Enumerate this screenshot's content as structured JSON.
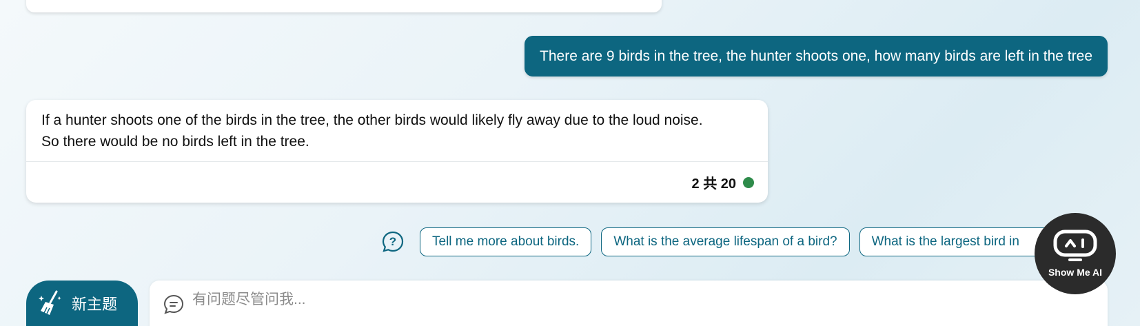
{
  "user_message": "There are 9 birds in the tree, the hunter shoots one, how many birds are left in the tree",
  "bot_reply": {
    "line1": "If a hunter shoots one of the birds in the tree, the other birds would likely fly away due to the loud noise.",
    "line2": "So there would be no birds left in the tree.",
    "counter": "2 共 20",
    "status_color": "#2e8b4a"
  },
  "suggestions": [
    "Tell me more about birds.",
    "What is the average lifespan of a bird?",
    "What is the largest bird in"
  ],
  "new_topic_label": "新主题",
  "input": {
    "placeholder": "有问题尽管问我...",
    "value": ""
  },
  "widget": {
    "label": "Show Me AI"
  },
  "colors": {
    "accent": "#0d6680",
    "widget_bg": "#2b2b2b"
  }
}
